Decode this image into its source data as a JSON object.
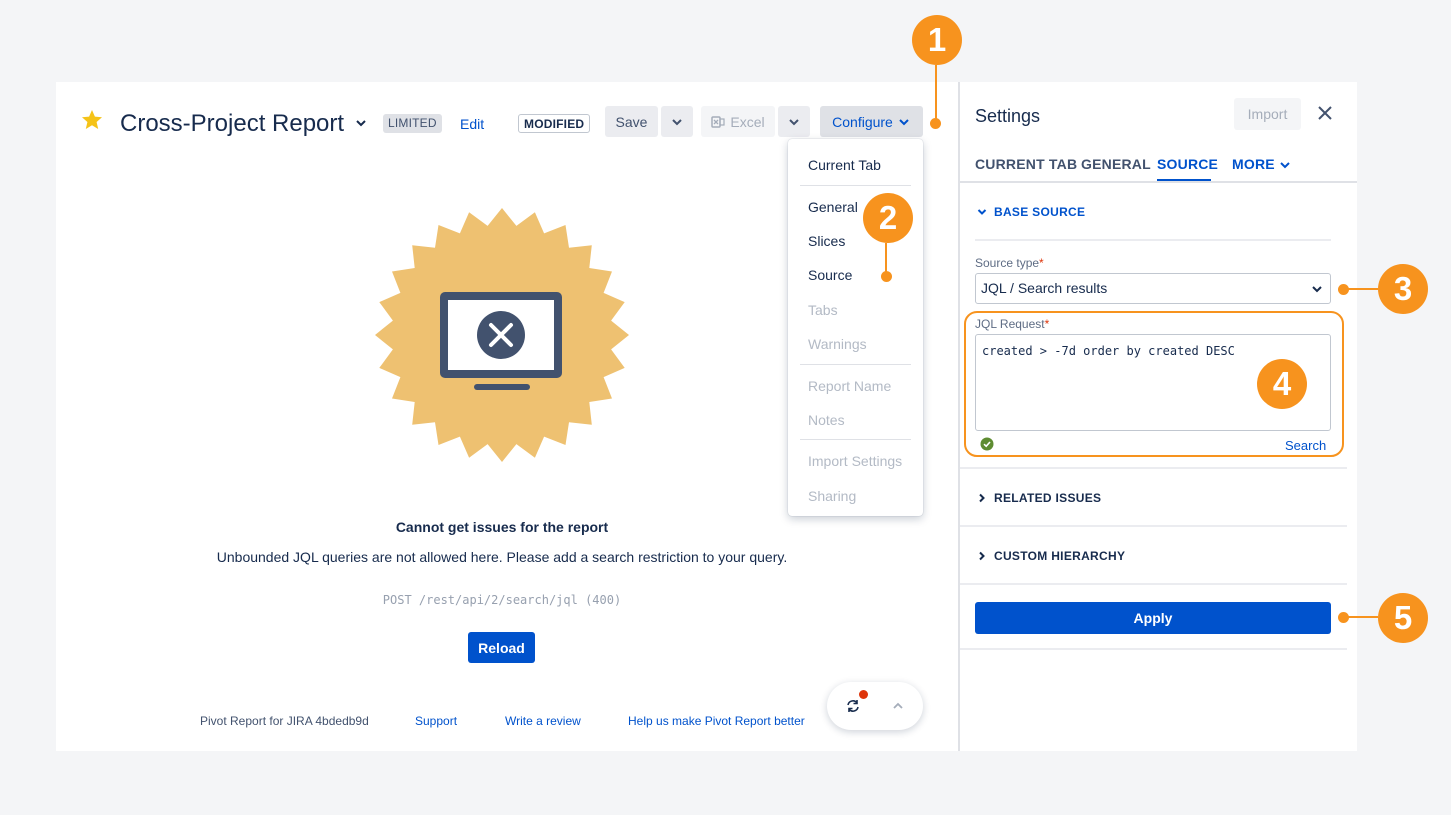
{
  "header": {
    "title": "Cross-Project Report",
    "limited_badge": "LIMITED",
    "edit_link": "Edit",
    "modified_badge": "MODIFIED",
    "save_label": "Save",
    "excel_label": "Excel",
    "configure_label": "Configure"
  },
  "configure_menu": {
    "items": [
      {
        "label": "Current Tab",
        "enabled": true
      },
      {
        "label": "General",
        "enabled": true
      },
      {
        "label": "Slices",
        "enabled": true
      },
      {
        "label": "Source",
        "enabled": true
      },
      {
        "label": "Tabs",
        "enabled": false
      },
      {
        "label": "Warnings",
        "enabled": false
      },
      {
        "label": "Report Name",
        "enabled": false
      },
      {
        "label": "Notes",
        "enabled": false
      },
      {
        "label": "Import Settings",
        "enabled": false
      },
      {
        "label": "Sharing",
        "enabled": false
      }
    ]
  },
  "error": {
    "title": "Cannot get issues for the report",
    "message": "Unbounded JQL queries are not allowed here. Please add a search restriction to your query.",
    "code": "POST /rest/api/2/search/jql (400)",
    "reload_label": "Reload"
  },
  "footer": {
    "version": "Pivot Report for JIRA 4bdedb9d",
    "support": "Support",
    "review": "Write a review",
    "feedback": "Help us make Pivot Report better"
  },
  "settings": {
    "title": "Settings",
    "import_label": "Import",
    "tabs": [
      "CURRENT TAB",
      "GENERAL",
      "SOURCE",
      "MORE"
    ],
    "active_tab": "SOURCE",
    "base_source_label": "BASE SOURCE",
    "source_type_label": "Source type",
    "source_type_value": "JQL / Search results",
    "jql_label": "JQL Request",
    "jql_value": "created > -7d order by created DESC",
    "search_link": "Search",
    "related_issues_label": "RELATED ISSUES",
    "custom_hierarchy_label": "CUSTOM HIERARCHY",
    "apply_label": "Apply",
    "required_mark": "*"
  },
  "callouts": [
    "1",
    "2",
    "3",
    "4",
    "5"
  ],
  "colors": {
    "accent": "#0052cc",
    "callout": "#f7931e",
    "badge_art": "#eec171",
    "monitor": "#42526e",
    "error_dot": "#de350b",
    "ok": "#5e8c31"
  }
}
